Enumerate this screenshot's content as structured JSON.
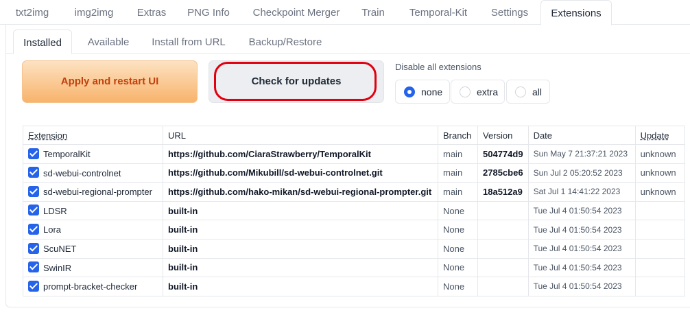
{
  "top_tabs": [
    {
      "label": "txt2img"
    },
    {
      "label": "img2img"
    },
    {
      "label": "Extras"
    },
    {
      "label": "PNG Info"
    },
    {
      "label": "Checkpoint Merger"
    },
    {
      "label": "Train"
    },
    {
      "label": "Temporal-Kit"
    },
    {
      "label": "Settings"
    },
    {
      "label": "Extensions",
      "active": true
    }
  ],
  "sub_tabs": [
    {
      "label": "Installed",
      "active": true
    },
    {
      "label": "Available"
    },
    {
      "label": "Install from URL"
    },
    {
      "label": "Backup/Restore"
    }
  ],
  "buttons": {
    "apply": "Apply and restart UI",
    "check": "Check for updates"
  },
  "disable": {
    "label": "Disable all extensions",
    "options": [
      "none",
      "extra",
      "all"
    ],
    "selected": "none"
  },
  "colors": {
    "accent": "#2563eb",
    "apply_text": "#c2410c",
    "highlight": "#e0000f"
  },
  "table": {
    "headers": {
      "extension": "Extension",
      "url": "URL",
      "branch": "Branch",
      "version": "Version",
      "date": "Date",
      "update": "Update"
    },
    "rows": [
      {
        "name": "TemporalKit",
        "url": "https://github.com/CiaraStrawberry/TemporalKit",
        "branch": "main",
        "version": "504774d9",
        "date": "Sun May 7 21:37:21 2023",
        "update": "unknown",
        "enabled": true
      },
      {
        "name": "sd-webui-controlnet",
        "url": "https://github.com/Mikubill/sd-webui-controlnet.git",
        "branch": "main",
        "version": "2785cbe6",
        "date": "Sun Jul 2 05:20:52 2023",
        "update": "unknown",
        "enabled": true
      },
      {
        "name": "sd-webui-regional-prompter",
        "url": "https://github.com/hako-mikan/sd-webui-regional-prompter.git",
        "branch": "main",
        "version": "18a512a9",
        "date": "Sat Jul 1 14:41:22 2023",
        "update": "unknown",
        "enabled": true
      },
      {
        "name": "LDSR",
        "url": "built-in",
        "branch": "None",
        "version": "",
        "date": "Tue Jul 4 01:50:54 2023",
        "update": "",
        "enabled": true
      },
      {
        "name": "Lora",
        "url": "built-in",
        "branch": "None",
        "version": "",
        "date": "Tue Jul 4 01:50:54 2023",
        "update": "",
        "enabled": true
      },
      {
        "name": "ScuNET",
        "url": "built-in",
        "branch": "None",
        "version": "",
        "date": "Tue Jul 4 01:50:54 2023",
        "update": "",
        "enabled": true
      },
      {
        "name": "SwinIR",
        "url": "built-in",
        "branch": "None",
        "version": "",
        "date": "Tue Jul 4 01:50:54 2023",
        "update": "",
        "enabled": true
      },
      {
        "name": "prompt-bracket-checker",
        "url": "built-in",
        "branch": "None",
        "version": "",
        "date": "Tue Jul 4 01:50:54 2023",
        "update": "",
        "enabled": true
      }
    ]
  }
}
